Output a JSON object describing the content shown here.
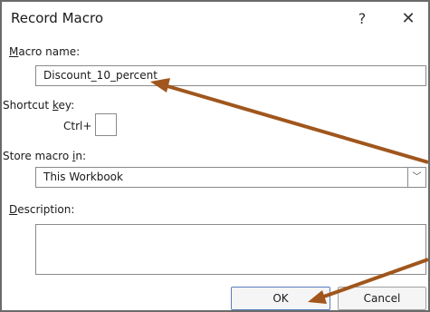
{
  "dialog": {
    "title": "Record Macro",
    "help_icon": "?",
    "close_icon": "✕"
  },
  "macro_name": {
    "label_accel": "M",
    "label_rest": "acro name:",
    "value": "Discount_10_percent"
  },
  "shortcut": {
    "label_pre": "Shortcut ",
    "label_accel": "k",
    "label_post": "ey:",
    "ctrl_label": "Ctrl+",
    "value": ""
  },
  "store": {
    "label_pre": "Store macro ",
    "label_accel": "i",
    "label_post": "n:",
    "selected": "This Workbook",
    "dropdown_icon": "﹀"
  },
  "description": {
    "label_accel": "D",
    "label_rest": "escription:",
    "value": ""
  },
  "buttons": {
    "ok": "OK",
    "cancel": "Cancel"
  },
  "annotation": {
    "arrow_color": "#a0561c"
  }
}
